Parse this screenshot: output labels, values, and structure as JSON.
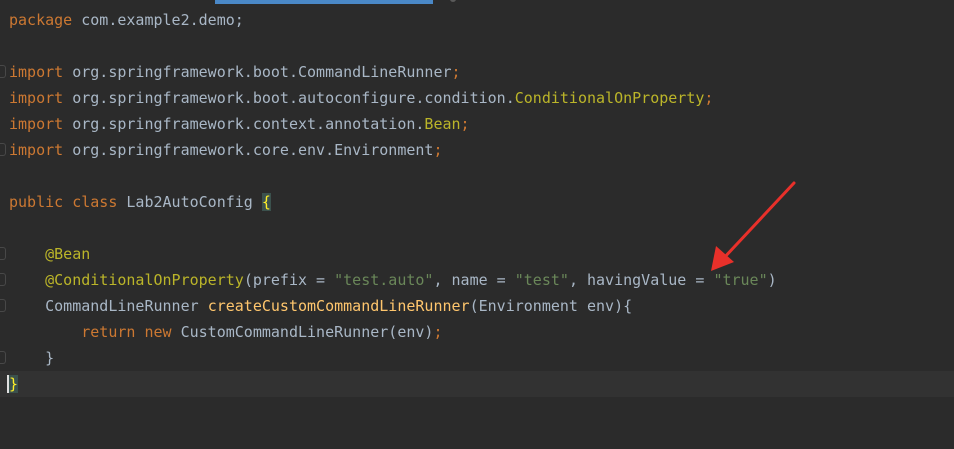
{
  "editor": {
    "lines": {
      "l1": {
        "kw": "package",
        "rest": " com.example2.demo;"
      },
      "l3": {
        "kw": "import",
        "pkg": " org.springframework.boot.CommandLineRunner",
        "semi": ";"
      },
      "l4": {
        "kw": "import",
        "pkg": " org.springframework.boot.autoconfigure.condition.",
        "cls": "ConditionalOnProperty",
        "semi": ";"
      },
      "l5": {
        "kw": "import",
        "pkg": " org.springframework.context.annotation.",
        "cls": "Bean",
        "semi": ";"
      },
      "l6": {
        "kw": "import",
        "pkg": " org.springframework.core.env.Environment",
        "semi": ";"
      },
      "l8": {
        "kw1": "public",
        "kw2": "class",
        "name": "Lab2AutoConfig",
        "brace": "{"
      },
      "l10": {
        "ann": "@Bean"
      },
      "l11": {
        "ann": "@ConditionalOnProperty",
        "p1": "(prefix = ",
        "s1": "\"test.auto\"",
        "p2": ", name = ",
        "s2": "\"test\"",
        "p3": ", havingValue = ",
        "s3": "\"true\"",
        "p4": ")"
      },
      "l12": {
        "type": "CommandLineRunner",
        "method": "createCustomCommandLineRunner",
        "params": "(Environment env){"
      },
      "l13": {
        "kw1": "return",
        "kw2": "new",
        "call": "CustomCommandLineRunner(env)",
        "semi": ";"
      },
      "l14": {
        "brace": "}"
      },
      "l15": {
        "brace": "}"
      }
    }
  },
  "colors": {
    "background": "#2b2b2b",
    "keyword": "#cc7832",
    "annotation": "#bbb529",
    "string": "#6a8759",
    "function": "#ffc66d",
    "text": "#a9b7c6",
    "arrow": "#e8302a"
  }
}
